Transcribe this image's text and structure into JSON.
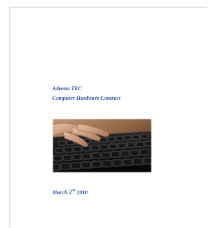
{
  "document": {
    "company": "Adeona TEC",
    "subject": "Computer Hardware Contract",
    "date_prefix": "March 2",
    "date_ordinal": "nd",
    "date_year": " 2010"
  },
  "image": {
    "subject": "hands typing on a black computer keyboard"
  },
  "colors": {
    "heading_text": "#2e56a6",
    "page_background": "#ffffff",
    "keyboard_keys": "#111111"
  }
}
